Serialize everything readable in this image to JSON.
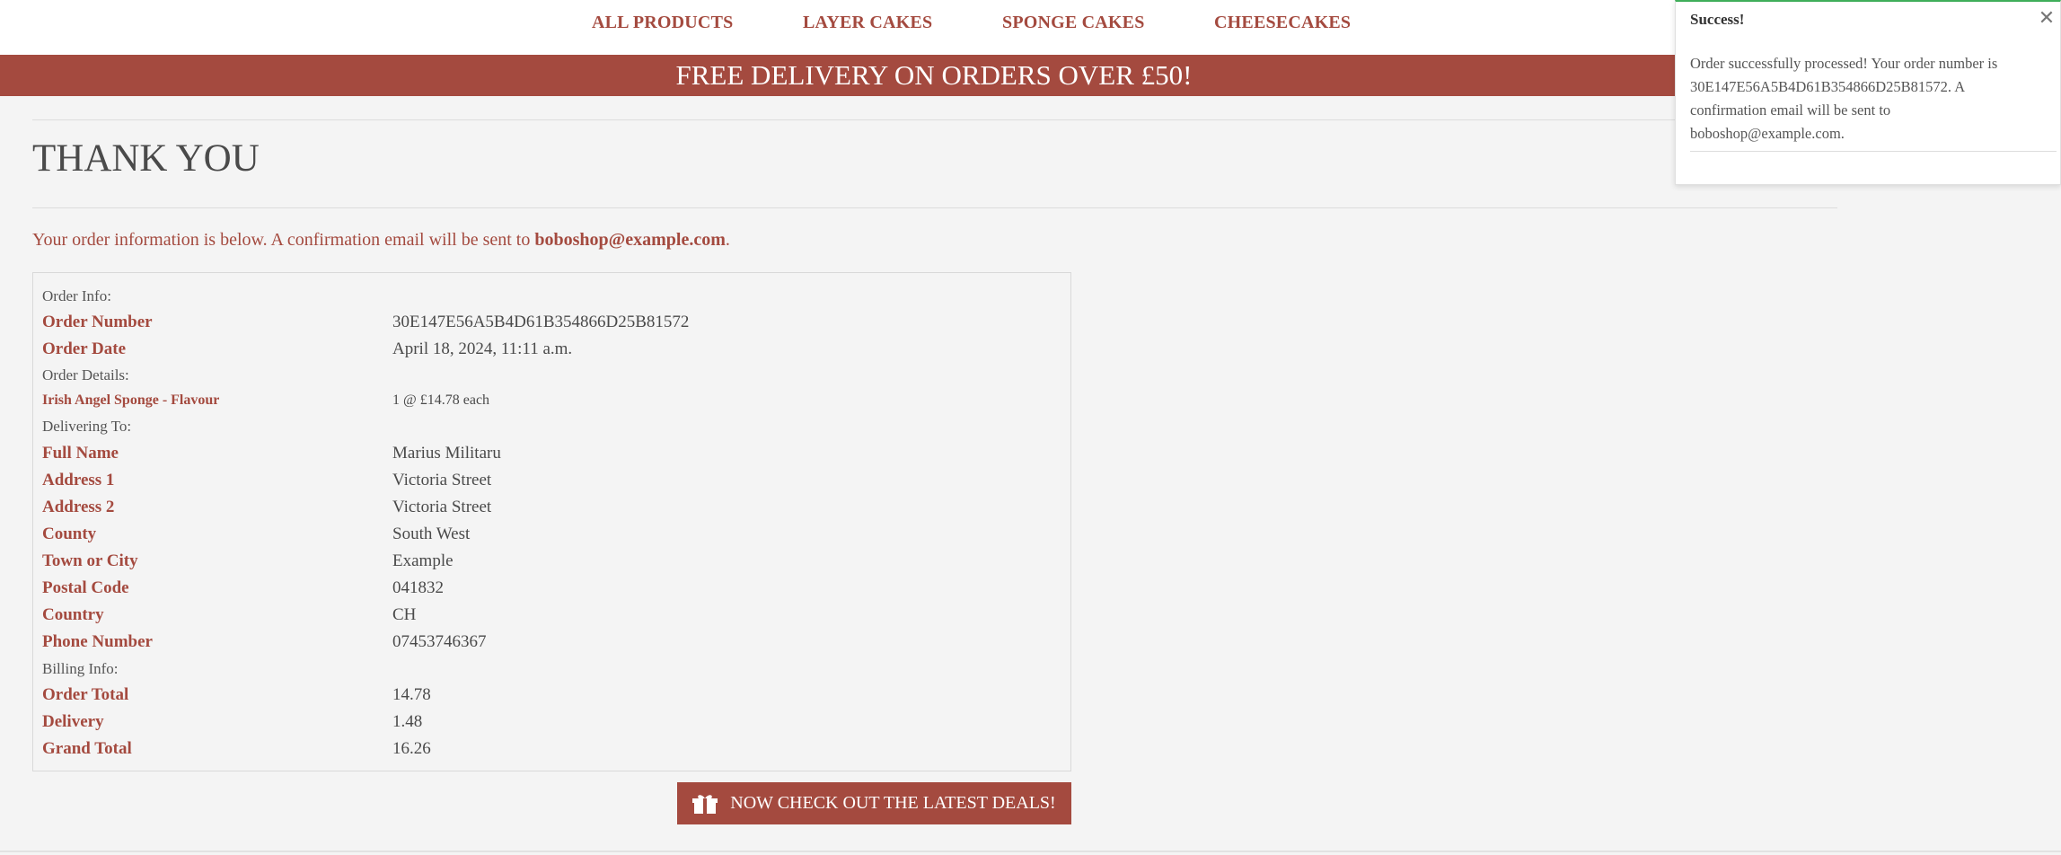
{
  "nav": {
    "items": [
      "ALL PRODUCTS",
      "LAYER CAKES",
      "SPONGE CAKES",
      "CHEESECAKES"
    ]
  },
  "banner": {
    "text": "FREE DELIVERY ON ORDERS OVER £50!"
  },
  "page": {
    "title": "THANK YOU",
    "intro_prefix": "Your order information is below. A confirmation email will be sent to ",
    "intro_email": "boboshop@example.com",
    "intro_suffix": "."
  },
  "order": {
    "sections": {
      "order_info": "Order Info:",
      "order_details": "Order Details:",
      "delivering_to": "Delivering To:",
      "billing_info": "Billing Info:"
    },
    "order_number": {
      "label": "Order Number",
      "value": "30E147E56A5B4D61B354866D25B81572"
    },
    "order_date": {
      "label": "Order Date",
      "value": "April 18, 2024, 11:11 a.m."
    },
    "item": {
      "label": "Irish Angel Sponge - Flavour",
      "value": "1 @ £14.78 each"
    },
    "delivery_fields": [
      {
        "label": "Full Name",
        "value": "Marius Militaru"
      },
      {
        "label": "Address 1",
        "value": "Victoria Street"
      },
      {
        "label": "Address 2",
        "value": "Victoria Street"
      },
      {
        "label": "County",
        "value": "South West"
      },
      {
        "label": "Town or City",
        "value": "Example"
      },
      {
        "label": "Postal Code",
        "value": "041832"
      },
      {
        "label": "Country",
        "value": "CH"
      },
      {
        "label": "Phone Number",
        "value": "07453746367"
      }
    ],
    "billing_fields": [
      {
        "label": "Order Total",
        "value": "14.78"
      },
      {
        "label": "Delivery",
        "value": "1.48"
      },
      {
        "label": "Grand Total",
        "value": "16.26"
      }
    ]
  },
  "deals_button": {
    "label": "NOW CHECK OUT THE LATEST DEALS!",
    "icon": "gift-icon"
  },
  "toast": {
    "title": "Success!",
    "message": "Order successfully processed! Your order number is 30E147E56A5B4D61B354866D25B81572. A confirmation email will be sent to boboshop@example.com.",
    "close_icon": "close-icon"
  },
  "colors": {
    "brand": "#a44a3f",
    "background": "#f4f4f4",
    "success": "#3fae5a"
  }
}
